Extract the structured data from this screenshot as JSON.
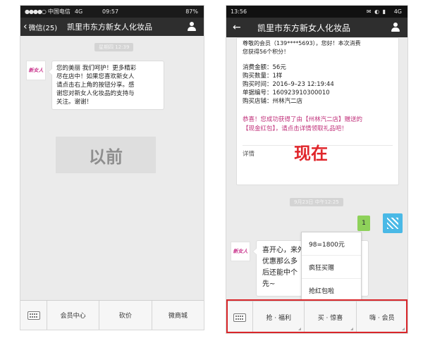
{
  "left_phone": {
    "status": {
      "carrier": "中国电信",
      "network": "4G",
      "time": "09:57",
      "battery": "87%"
    },
    "nav": {
      "back_label": "微信(25)",
      "title": "凯里市东方新女人化妆品"
    },
    "time_pill": "星期四 12:39",
    "avatar_text": "新女人",
    "message_lines": [
      "您的美丽 我们呵护！更多精彩",
      "尽在店中！如果您喜欢新女人",
      "请点击右上角的按钮分享。感",
      "谢您对新女人化妆品的支持与",
      "关注。谢谢！"
    ],
    "label": "以前",
    "menu": [
      "会员中心",
      "砍价",
      "微商城"
    ]
  },
  "right_phone": {
    "status": {
      "time": "13:56",
      "network": "4G"
    },
    "nav": {
      "title": "凯里市东方新女人化妆品"
    },
    "card": {
      "greeting_lines": [
        "尊敬的会员（139****5693），您好！本次消费",
        "您获得56个积分！"
      ],
      "details": [
        {
          "label": "消费金额：",
          "value": "56元"
        },
        {
          "label": "购买数量：",
          "value": "1样"
        },
        {
          "label": "购买时间：",
          "value": "2016–9–23 12:19:44"
        },
        {
          "label": "单据编号：",
          "value": "160923910300010"
        },
        {
          "label": "购买店铺：",
          "value": "州林汽二店"
        }
      ],
      "promo_lines": [
        "恭喜！您成功获得了由【州林汽二店】赠送的",
        "【现金红包】，请点击详情领取礼品吧！"
      ],
      "detail_link": "详情"
    },
    "label": "现在",
    "time_pill": "9月23日 中午12:25",
    "badge": "1",
    "avatar_text": "新女人",
    "message_lines": [
      "喜开心，来外",
      "优惠那么多",
      "后还能中个",
      "先~"
    ],
    "popup": [
      "98=1800元",
      "疯狂买赠",
      "抢红包啦"
    ],
    "menu": [
      "抢 · 福利",
      "买 · 惊喜",
      "嗨 · 会员"
    ],
    "colors": {
      "highlight_box": "#d9262a",
      "promo_text": "#c0307a",
      "label_red": "#e0262b",
      "nav_bg": "#2e2e2e",
      "badge_green": "#8ed15a",
      "qr_blue": "#4ab9e6"
    }
  }
}
